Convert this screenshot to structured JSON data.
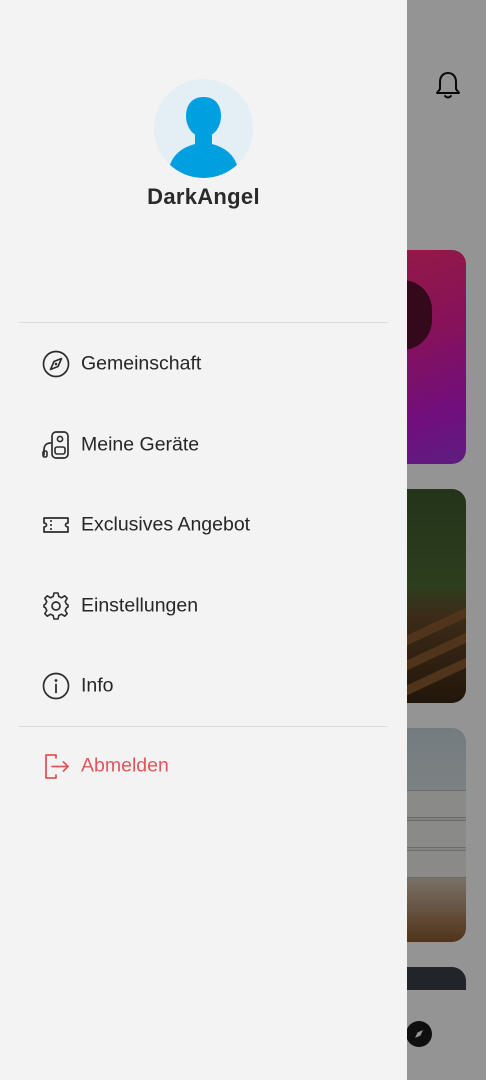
{
  "profile": {
    "username": "DarkAngel",
    "avatar_icon": "person-silhouette-icon",
    "avatar_color": "#00a0e0"
  },
  "menu": {
    "items": [
      {
        "label": "Gemeinschaft",
        "icon": "compass-icon"
      },
      {
        "label": "Meine Geräte",
        "icon": "devices-icon"
      },
      {
        "label": "Exclusives Angebot",
        "icon": "ticket-icon"
      },
      {
        "label": "Einstellungen",
        "icon": "gear-icon"
      },
      {
        "label": "Info",
        "icon": "info-icon"
      }
    ],
    "logout": {
      "label": "Abmelden",
      "icon": "logout-icon",
      "color": "#e0565a"
    }
  },
  "background": {
    "header_icon": "bell-icon",
    "bottom_nav_icon": "compass-icon"
  }
}
